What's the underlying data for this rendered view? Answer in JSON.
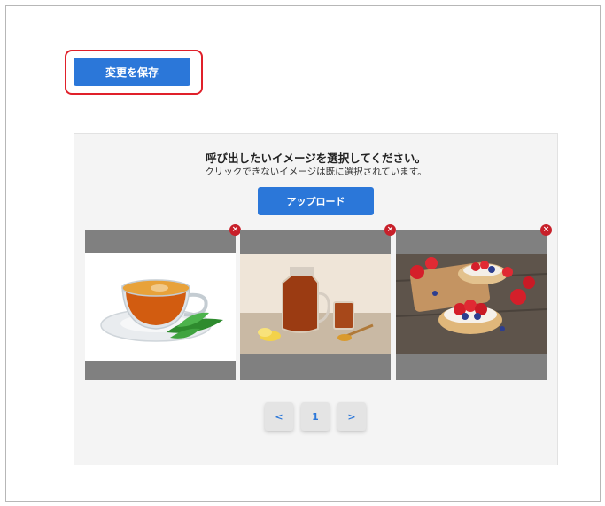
{
  "toolbar": {
    "save_label": "変更を保存"
  },
  "picker": {
    "title": "呼び出したいイメージを選択してください。",
    "subtitle": "クリックできないイメージは既に選択されています。",
    "upload_label": "アップロード",
    "images": [
      {
        "subject": "tea cup on saucer with mint leaves",
        "delete_label": "×"
      },
      {
        "subject": "iced tea in glass pot with lemon",
        "delete_label": "×"
      },
      {
        "subject": "strawberry blueberry tarts on wood",
        "delete_label": "×"
      }
    ]
  },
  "pagination": {
    "prev": "<",
    "current": "1",
    "next": ">"
  },
  "colors": {
    "accent": "#2b77d9",
    "highlight": "#e0202a",
    "delete": "#c8202a",
    "thumb_bg": "#808080"
  }
}
